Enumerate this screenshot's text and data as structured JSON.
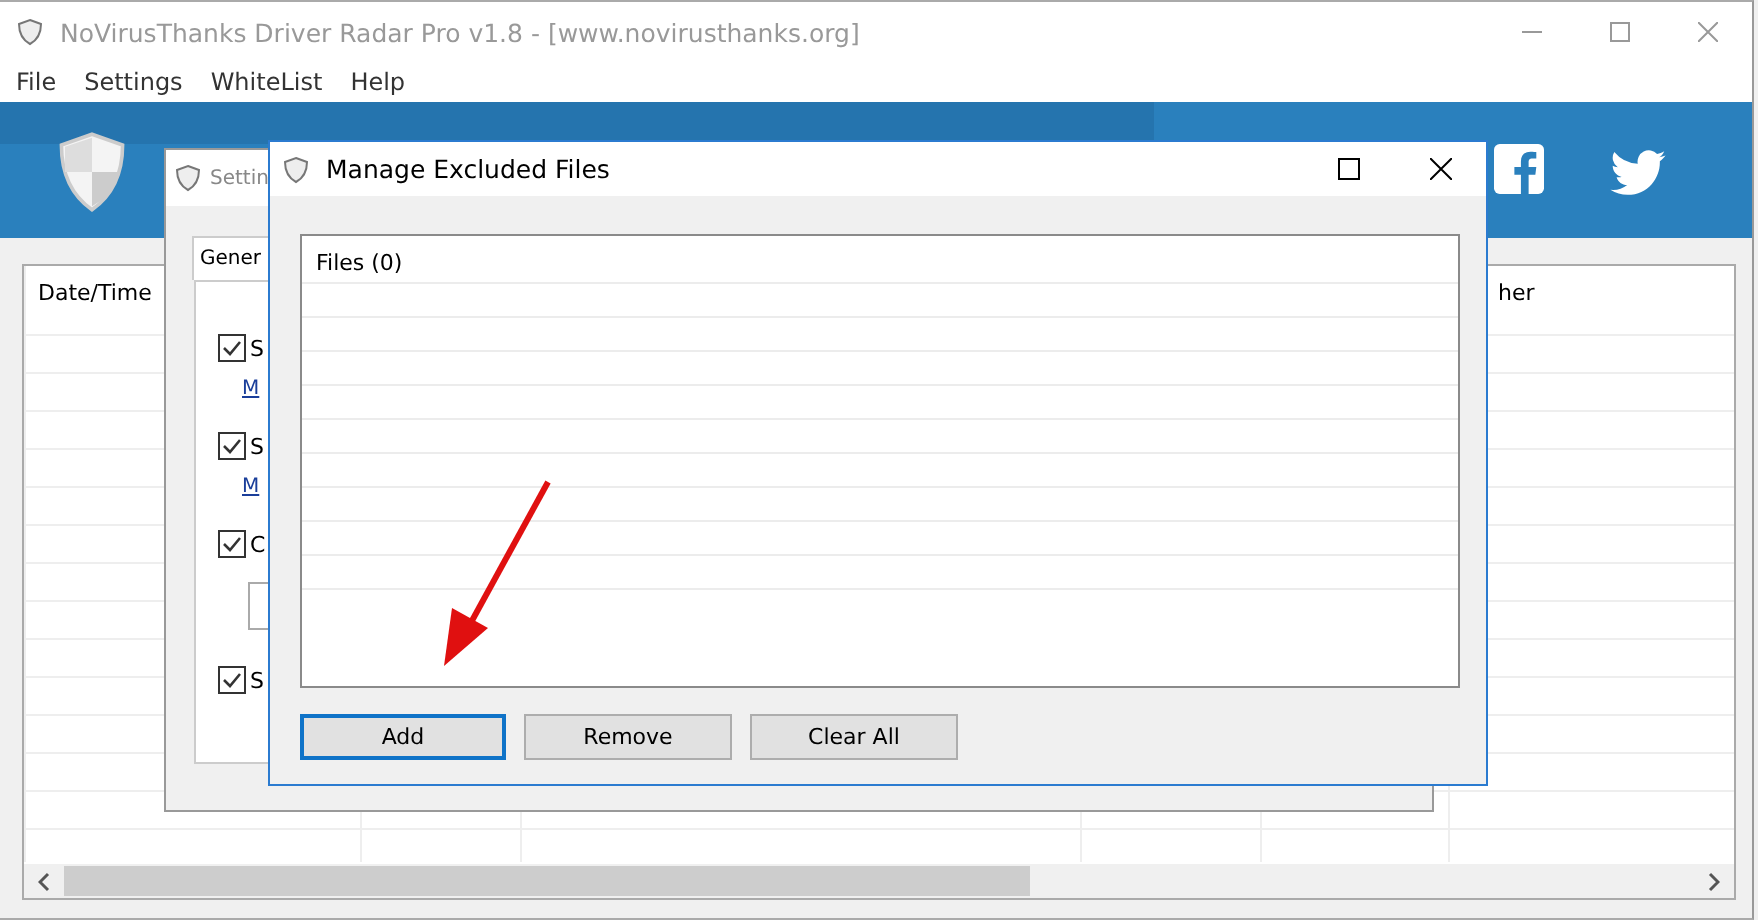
{
  "main_window": {
    "title": "NoVirusThanks Driver Radar Pro v1.8 - [www.novirusthanks.org]",
    "menu": [
      "File",
      "Settings",
      "WhiteList",
      "Help"
    ],
    "table": {
      "columns": [
        "Date/Time",
        "her"
      ]
    }
  },
  "settings_window": {
    "title": "Settin",
    "tabs": [
      {
        "label": "Gener",
        "selected": true
      }
    ],
    "options": [
      {
        "kind": "checkbox",
        "label": "S",
        "checked": true
      },
      {
        "kind": "link",
        "label": "M"
      },
      {
        "kind": "checkbox",
        "label": "S",
        "checked": true
      },
      {
        "kind": "link",
        "label": "M"
      },
      {
        "kind": "checkbox",
        "label": "C",
        "checked": true
      },
      {
        "kind": "field"
      },
      {
        "kind": "checkbox",
        "label": "S",
        "checked": true
      }
    ]
  },
  "dialog": {
    "title": "Manage Excluded Files",
    "list_header": "Files (0)",
    "buttons": [
      {
        "label": "Add",
        "focused": true
      },
      {
        "label": "Remove",
        "focused": false
      },
      {
        "label": "Clear All",
        "focused": false
      }
    ]
  }
}
